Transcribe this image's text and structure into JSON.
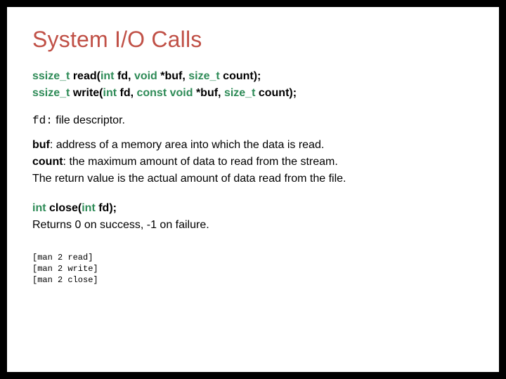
{
  "title": "System I/O Calls",
  "sig": {
    "read": {
      "ret": "ssize_t",
      "name": " read(",
      "p1t": "int",
      "p1": " fd, ",
      "p2t": "void",
      "p2": " *buf, ",
      "p3t": "size_t",
      "p3": " count);"
    },
    "write": {
      "ret": "ssize_t",
      "name": " write(",
      "p1t": "int",
      "p1": " fd, ",
      "p2t": "const void",
      "p2": " *buf, ",
      "p3t": "size_t",
      "p3": " count);"
    }
  },
  "fd": {
    "label": "fd:",
    "desc": " file descriptor."
  },
  "buf": {
    "label": "buf",
    "colon": ": ",
    "desc": "address of a memory area into which the data is read."
  },
  "count": {
    "label": "count",
    "colon": ": ",
    "desc": "the maximum amount of data to read from the stream."
  },
  "retline": "The return value is the actual amount of data read from the file.",
  "close": {
    "ret": "int",
    "name": " close(",
    "pt": "int",
    "p": " fd);"
  },
  "closeRet": "Returns 0 on success, -1 on failure.",
  "man": "[man 2 read]\n[man 2 write]\n[man 2 close]"
}
